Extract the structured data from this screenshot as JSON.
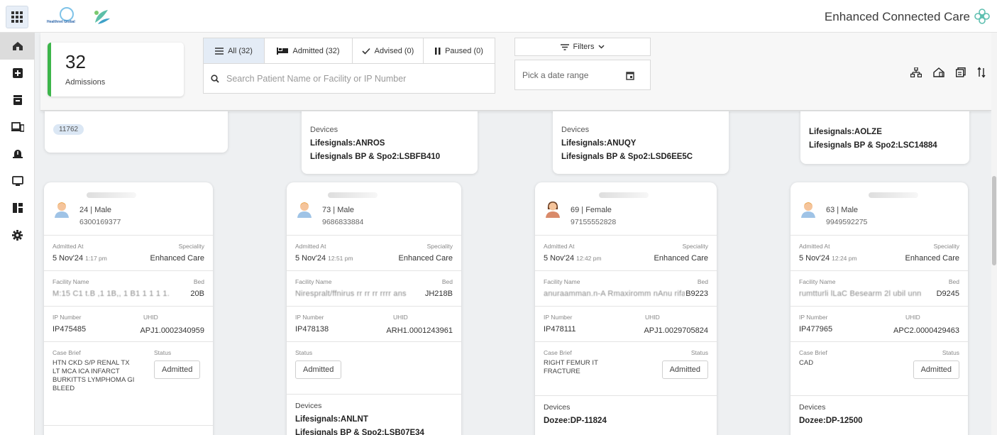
{
  "app": {
    "title": "Enhanced Connected Care",
    "logo_text": "Healthnet Global"
  },
  "sidebar": {
    "items": [
      "home",
      "add",
      "archive",
      "devices",
      "alerts",
      "monitor",
      "dashboard",
      "settings"
    ]
  },
  "summary": {
    "count": "32",
    "label": "Admissions"
  },
  "tabs": [
    {
      "label": "All (32)",
      "icon": "list-icon"
    },
    {
      "label": "Admitted (32)",
      "icon": "bed-icon"
    },
    {
      "label": "Advised (0)",
      "icon": "check-icon"
    },
    {
      "label": "Paused (0)",
      "icon": "pause-icon"
    }
  ],
  "search": {
    "placeholder": "Search Patient Name or Facility or IP Number"
  },
  "filters": {
    "label": "Filters"
  },
  "daterange": {
    "placeholder": "Pick a date range"
  },
  "top_cards": [
    {
      "uhid_chip": "11762"
    },
    {
      "devices_title": "Devices",
      "devices": [
        "Lifesignals:ANROS",
        "Lifesignals BP & Spo2:LSBFB410"
      ]
    },
    {
      "devices_title": "Devices",
      "devices": [
        "Lifesignals:ANUQY",
        "Lifesignals BP & Spo2:LSD6EE5C"
      ]
    },
    {
      "devices": [
        "Lifesignals:AOLZE",
        "Lifesignals BP & Spo2:LSC14884"
      ]
    }
  ],
  "labels": {
    "admitted_at": "Admitted At",
    "speciality": "Speciality",
    "facility": "Facility Name",
    "bed": "Bed",
    "ip": "IP Number",
    "uhid": "UHID",
    "case": "Case Brief",
    "status": "Status",
    "devices": "Devices"
  },
  "patients": [
    {
      "age_sex": "24 | Male",
      "phone": "6300169377",
      "gender": "male",
      "date": "5 Nov'24",
      "time": "1:17 pm",
      "speciality": "Enhanced Care",
      "facility": "M:15 C1 t.B ,1 1B,, 1 B1 1 1 1 1.",
      "bed": "20B",
      "ip": "IP475485",
      "uhid": "APJ1.0002340959",
      "case": "HTN CKD S/P RENAL Tx LT MCA ICA INFARCT BURKITTS LYMPHOMA GI BLEED",
      "status": "Admitted",
      "devices": []
    },
    {
      "age_sex": "73 | Male",
      "phone": "9686833884",
      "gender": "male",
      "date": "5 Nov'24",
      "time": "12:51 pm",
      "speciality": "Enhanced Care",
      "facility": "Nirespralt/ffnirus rr rr rr rrrr ans",
      "bed": "JH218B",
      "ip": "IP478138",
      "uhid": "ARH1.0001243961",
      "case": "",
      "status": "Admitted",
      "devices": [
        "Lifesignals:ANLNT",
        "Lifesignals BP & Spo2:LSB07E34"
      ]
    },
    {
      "age_sex": "69 | Female",
      "phone": "97155552828",
      "gender": "female",
      "date": "5 Nov'24",
      "time": "12:42 pm",
      "speciality": "Enhanced Care",
      "facility": "anuraamman.n-A Rmaxiromm nAnu rifa",
      "bed": "B9223",
      "ip": "IP478111",
      "uhid": "APJ1.0029705824",
      "case": "RIGHT FEMUR IT FRACTURE",
      "status": "Admitted",
      "devices": [
        "Dozee:DP-11824"
      ]
    },
    {
      "age_sex": "63 | Male",
      "phone": "9949592275",
      "gender": "male",
      "date": "5 Nov'24",
      "time": "12:24 pm",
      "speciality": "Enhanced Care",
      "facility": "rumtturli lLaC Besearm 2l ubil unn",
      "bed": "D9245",
      "ip": "IP477965",
      "uhid": "APC2.0000429463",
      "case": "CAD",
      "status": "Admitted",
      "devices": [
        "Dozee:DP-12500"
      ]
    }
  ]
}
